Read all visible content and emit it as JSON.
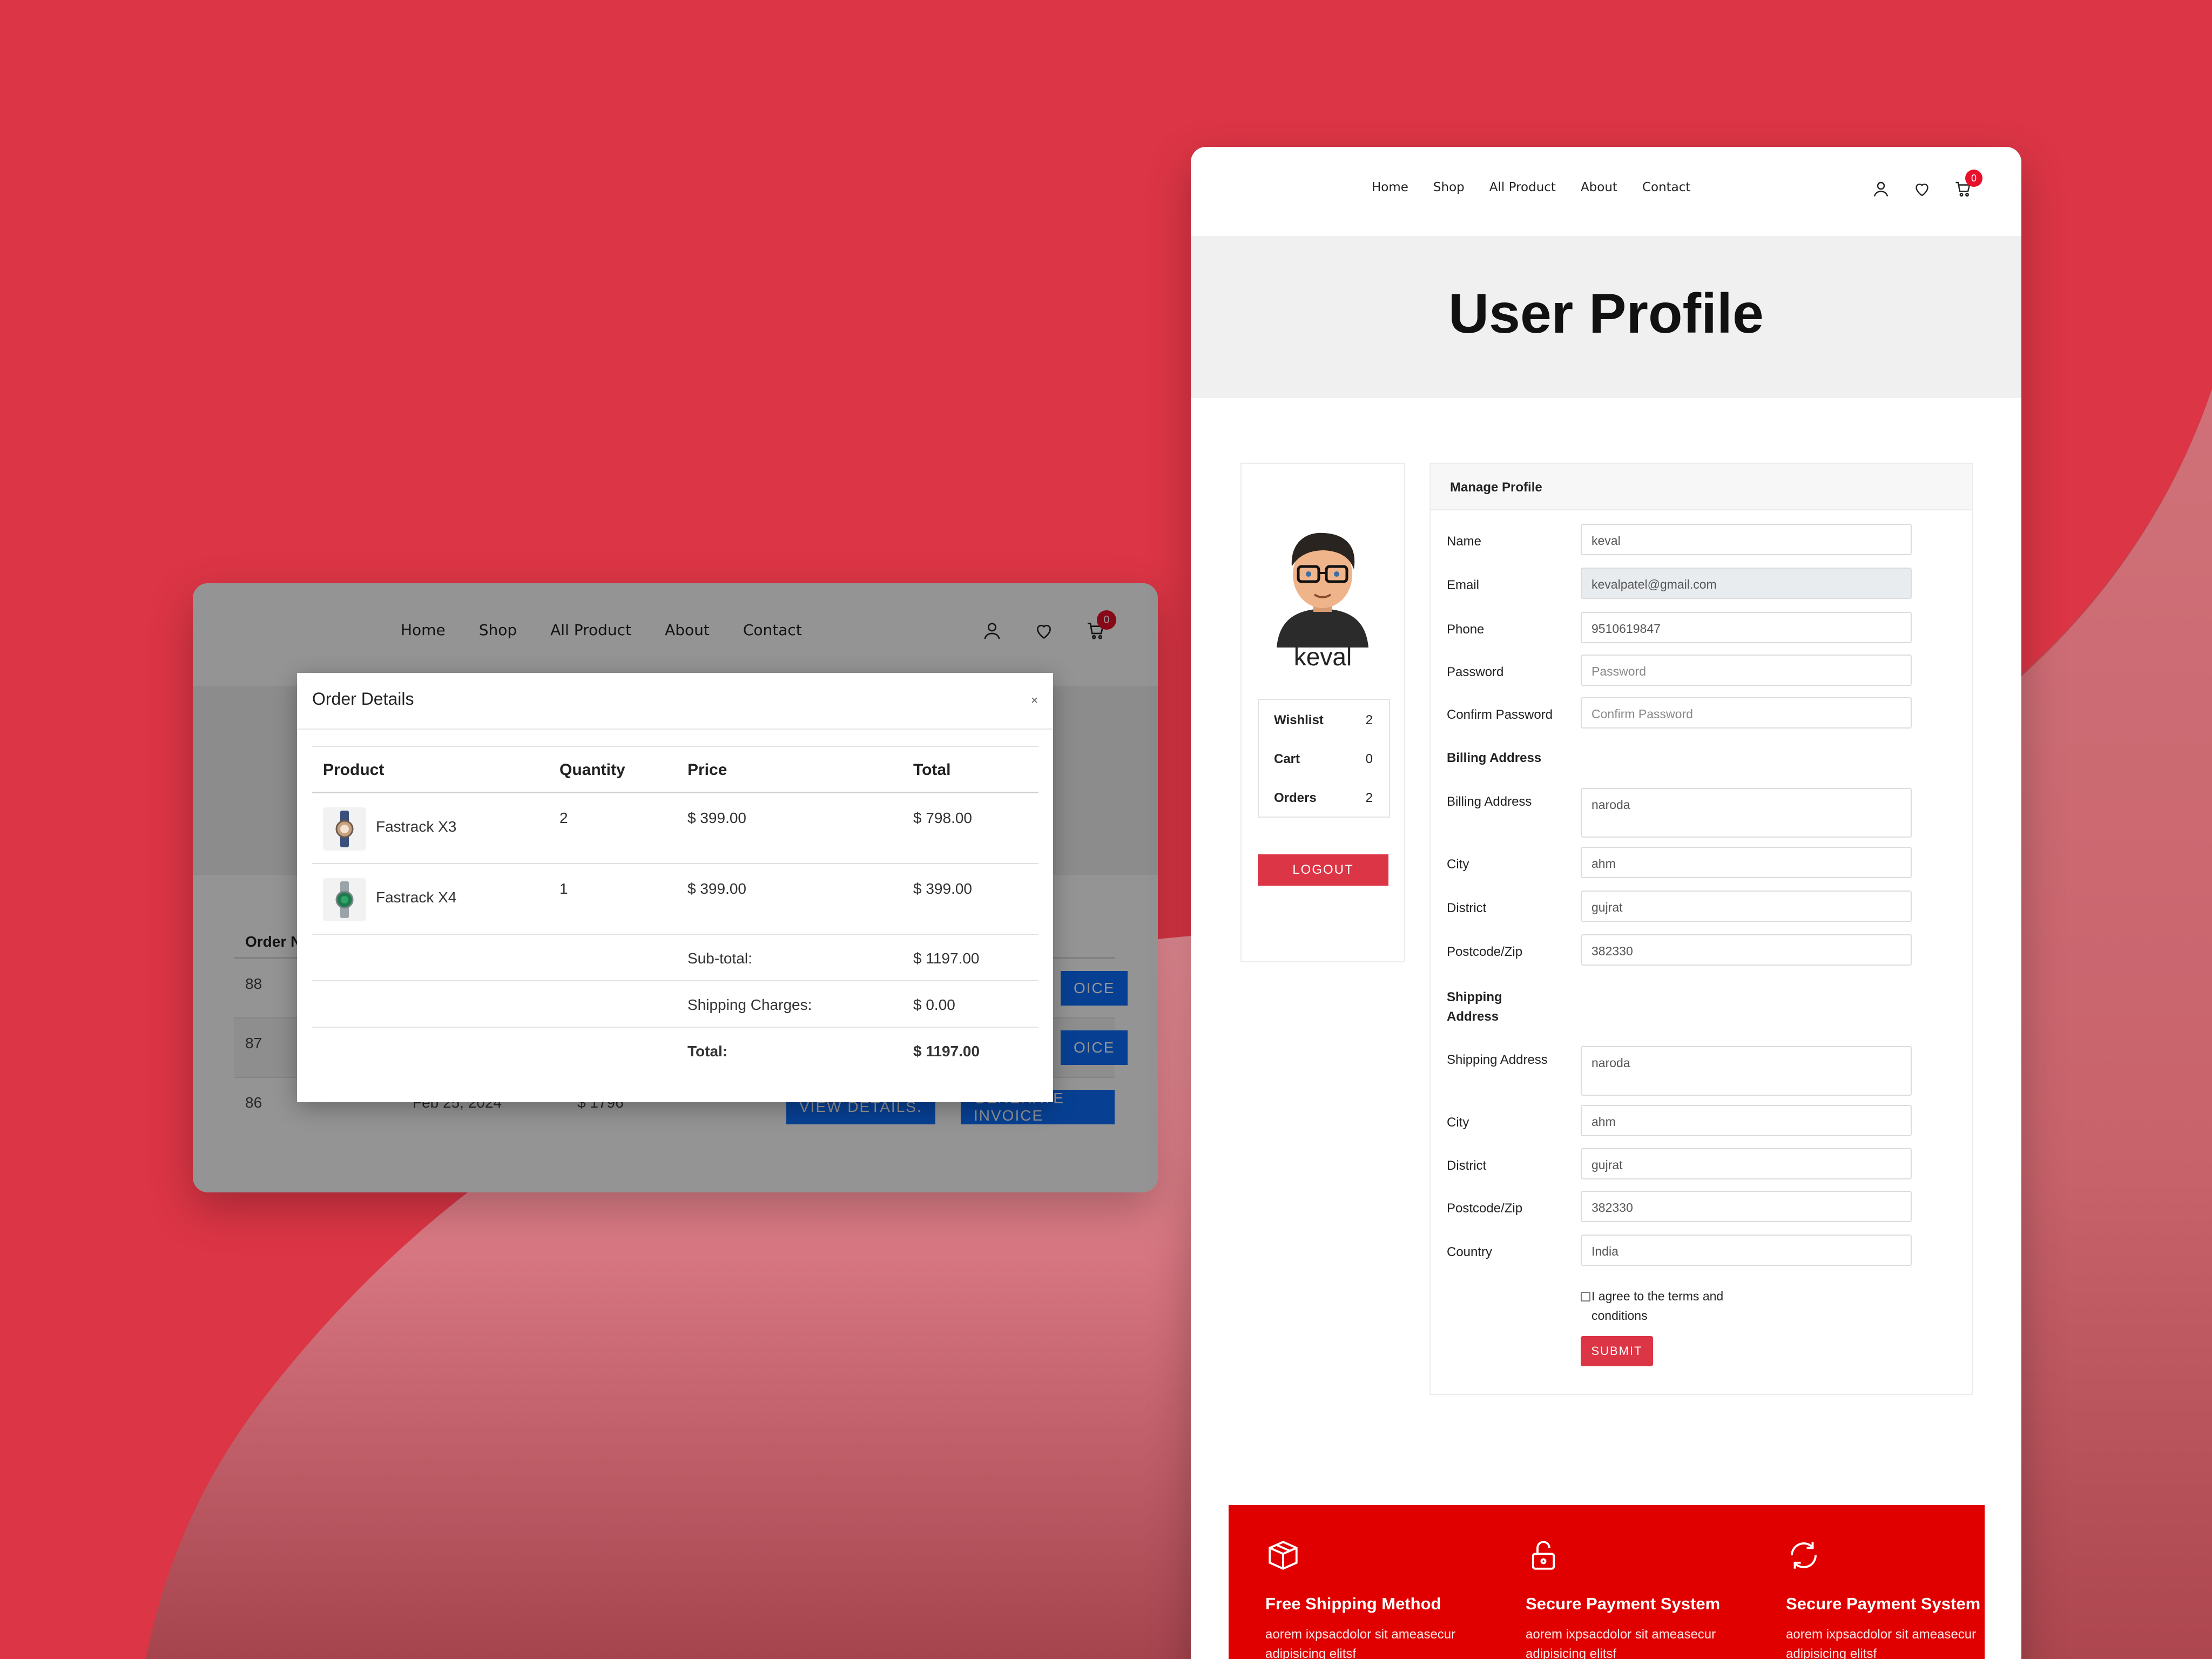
{
  "colors": {
    "accent": "#dc3545",
    "blue": "#0d6efd",
    "footer": "#e00000"
  },
  "left_card": {
    "nav": [
      "Home",
      "Shop",
      "All Product",
      "About",
      "Contact"
    ],
    "cart_count": "0",
    "orders_header": "Order N",
    "rows": [
      {
        "id": "88",
        "date": "",
        "amount": "",
        "invoice": "OICE"
      },
      {
        "id": "87",
        "date": "",
        "amount": "",
        "invoice": "OICE"
      },
      {
        "id": "86",
        "date": "Feb 25, 2024",
        "amount": "$ 1796",
        "view": "VIEW DETAILS.",
        "invoice": "GENERATE INVOICE"
      }
    ]
  },
  "modal": {
    "title": "Order Details",
    "close": "×",
    "headers": {
      "product": "Product",
      "quantity": "Quantity",
      "price": "Price",
      "total": "Total"
    },
    "items": [
      {
        "name": "Fastrack X3",
        "qty": "2",
        "price": "$ 399.00",
        "total": "$ 798.00"
      },
      {
        "name": "Fastrack X4",
        "qty": "1",
        "price": "$ 399.00",
        "total": "$ 399.00"
      }
    ],
    "subtotal_label": "Sub-total:",
    "subtotal": "$ 1197.00",
    "shipping_label": "Shipping Charges:",
    "shipping": "$ 0.00",
    "total_label": "Total:",
    "total": "$ 1197.00"
  },
  "right_card": {
    "nav": [
      "Home",
      "Shop",
      "All Product",
      "About",
      "Contact"
    ],
    "cart_count": "0",
    "title": "User Profile",
    "user": {
      "name": "keval"
    },
    "stats": [
      {
        "label": "Wishlist",
        "value": "2"
      },
      {
        "label": "Cart",
        "value": "0"
      },
      {
        "label": "Orders",
        "value": "2"
      }
    ],
    "logout": "LOGOUT",
    "form": {
      "heading": "Manage Profile",
      "name_label": "Name",
      "name": "keval",
      "email_label": "Email",
      "email": "kevalpatel@gmail.com",
      "phone_label": "Phone",
      "phone": "9510619847",
      "password_label": "Password",
      "password_ph": "Password",
      "confirm_label": "Confirm Password",
      "confirm_ph": "Confirm Password",
      "billing_heading": "Billing Address",
      "billing_label": "Billing Address",
      "billing": "naroda",
      "city_label": "City",
      "city": "ahm",
      "district_label": "District",
      "district": "gujrat",
      "postcode_label": "Postcode/Zip",
      "postcode": "382330",
      "shipping_heading": "Shipping Address",
      "shipping_label": "Shipping Address",
      "shipping": "naroda",
      "s_city": "ahm",
      "s_district": "gujrat",
      "s_postcode": "382330",
      "country_label": "Country",
      "country": "India",
      "agree": "I agree to the terms and conditions",
      "submit": "SUBMIT"
    },
    "features": [
      {
        "title": "Free Shipping Method",
        "desc": "aorem ixpsacdolor sit ameasecur adipisicing elitsf"
      },
      {
        "title": "Secure Payment System",
        "desc": "aorem ixpsacdolor sit ameasecur adipisicing elitsf"
      },
      {
        "title": "Secure Payment System",
        "desc": "aorem ixpsacdolor sit ameasecur adipisicing elitsf"
      }
    ]
  }
}
